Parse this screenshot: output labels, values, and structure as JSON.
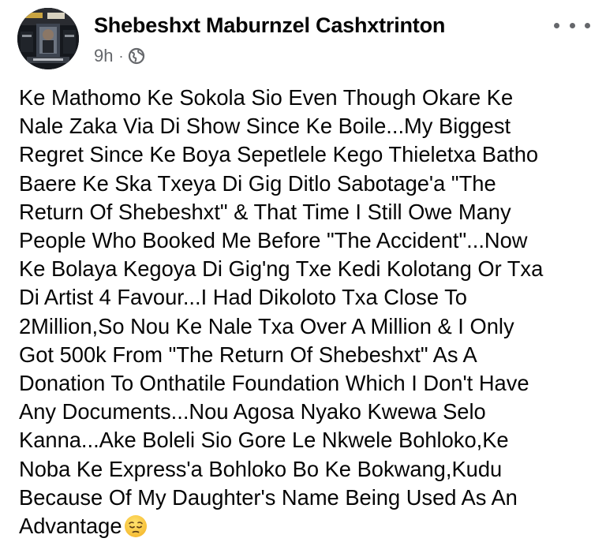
{
  "post": {
    "author_name": "Shebeshxt Maburnzel Cashxtrinton",
    "time_ago": "9h",
    "separator": "·",
    "privacy_icon": "globe-icon",
    "more_icon": "more-options-icon",
    "body_lines": [
      "Ke Mathomo Ke Sokola Sio Even Though Okare Ke",
      "Nale Zaka Via Di Show Since Ke Boile...My Biggest",
      "Regret Since Ke Boya Sepetlele Kego Thieletxa Batho",
      "Baere Ke Ska Txeya Di Gig Ditlo Sabotage'a \"The",
      "Return Of Shebeshxt\" & That Time I Still Owe Many",
      "People Who Booked Me Before \"The Accident\"...Now",
      "Ke Bolaya Kegoya Di Gig'ng Txe Kedi Kolotang Or Txa",
      "Di Artist 4 Favour...I Had Dikoloto Txa Close To",
      "2Million,So Nou Ke Nale Txa Over A Million & I Only",
      "Got 500k From \"The Return Of Shebeshxt\" As A",
      "Donation To Onthatile Foundation Which I Don't Have",
      "Any Documents...Nou Agosa Nyako Kwewa Selo",
      "Kanna...Ake Boleli Sio Gore Le Nkwele Bohloko,Ke",
      "Noba Ke Express'a Bohloko Bo Ke Bokwang,Kudu",
      "Because Of My Daughter's Name Being Used As An",
      "Advantage"
    ],
    "trailing_emoji": "pensive-face-emoji"
  },
  "colors": {
    "text": "#050505",
    "secondary_text": "#65676b",
    "background": "#ffffff"
  }
}
